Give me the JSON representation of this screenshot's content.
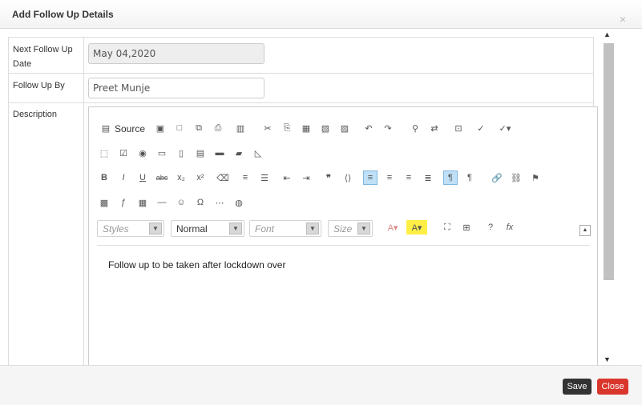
{
  "modal": {
    "title": "Add Follow Up Details",
    "close_glyph": "×"
  },
  "form": {
    "next_follow_up_label_1": "Next Follow Up",
    "next_follow_up_label_2": "Date",
    "next_follow_up_value": "May 04,2020",
    "follow_up_by_label": "Follow Up By",
    "follow_up_by_value": "Preet Munje",
    "description_label": "Description"
  },
  "editor": {
    "source_label": "Source",
    "styles_placeholder": "Styles",
    "format_value": "Normal",
    "font_placeholder": "Font",
    "size_placeholder": "Size",
    "content": "Follow up to be taken after lockdown over"
  },
  "footer": {
    "save_label": "Save",
    "close_label": "Close"
  },
  "colors": {
    "save": "#333333",
    "close": "#d9362c",
    "active_button": "#bfe0f6"
  }
}
